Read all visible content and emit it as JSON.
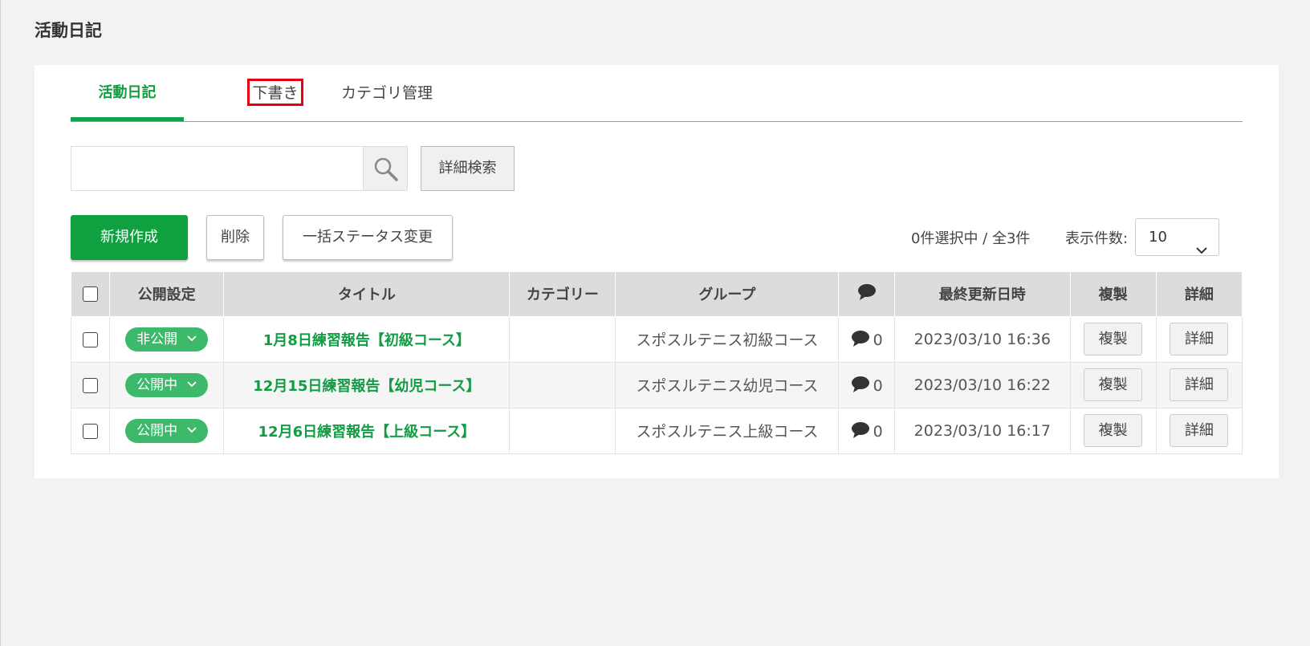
{
  "page_title": "活動日記",
  "tabs": [
    {
      "label": "活動日記"
    },
    {
      "label": "下書き"
    },
    {
      "label": "カテゴリ管理"
    }
  ],
  "search": {
    "value": "",
    "placeholder": ""
  },
  "advanced_search_label": "詳細検索",
  "actions": {
    "new_label": "新規作成",
    "delete_label": "削除",
    "bulk_status_label": "一括ステータス変更"
  },
  "selection_count": "0件選択中 / 全3件",
  "per_page": {
    "label": "表示件数:",
    "value": "10"
  },
  "table": {
    "headers": {
      "status": "公開設定",
      "title": "タイトル",
      "category": "カテゴリー",
      "group": "グループ",
      "comments_icon": "comment-icon",
      "updated": "最終更新日時",
      "copy": "複製",
      "detail": "詳細"
    },
    "rows": [
      {
        "status": "非公開",
        "title": "1月8日練習報告【初級コース】",
        "category": "",
        "group": "スポスルテニス初級コース",
        "comments": "0",
        "updated": "2023/03/10 16:36",
        "copy": "複製",
        "detail": "詳細"
      },
      {
        "status": "公開中",
        "title": "12月15日練習報告【幼児コース】",
        "category": "",
        "group": "スポスルテニス幼児コース",
        "comments": "0",
        "updated": "2023/03/10 16:22",
        "copy": "複製",
        "detail": "詳細"
      },
      {
        "status": "公開中",
        "title": "12月6日練習報告【上級コース】",
        "category": "",
        "group": "スポスルテニス上級コース",
        "comments": "0",
        "updated": "2023/03/10 16:17",
        "copy": "複製",
        "detail": "詳細"
      }
    ]
  },
  "colors": {
    "accent": "#0fa040",
    "status_pill": "#3cb96a",
    "highlight_border": "#e60012"
  }
}
